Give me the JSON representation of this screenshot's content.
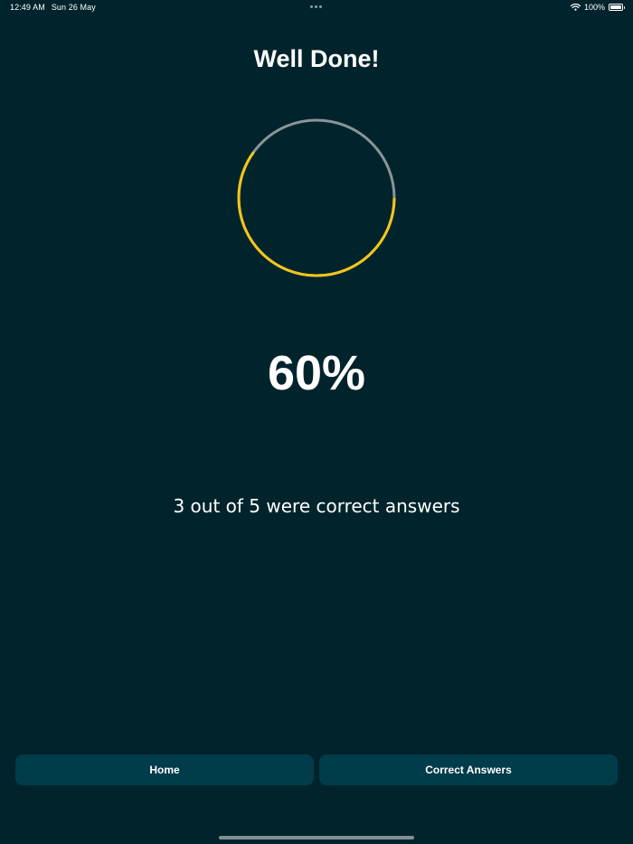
{
  "status_bar": {
    "time": "12:49 AM",
    "date": "Sun 26 May",
    "battery": "100%"
  },
  "result": {
    "title": "Well Done!",
    "percent_label": "60%",
    "score_fraction": 0.6,
    "summary": "3 out of 5 were correct answers"
  },
  "buttons": {
    "home_label": "Home",
    "correct_answers_label": "Correct Answers"
  },
  "colors": {
    "background": "#01242c",
    "progress": "#f5c518",
    "track": "#8a9599",
    "button": "#013c4b"
  },
  "icons": {
    "wifi": "wifi-icon",
    "battery": "battery-icon",
    "multitask": "multitasking-dots-icon"
  }
}
